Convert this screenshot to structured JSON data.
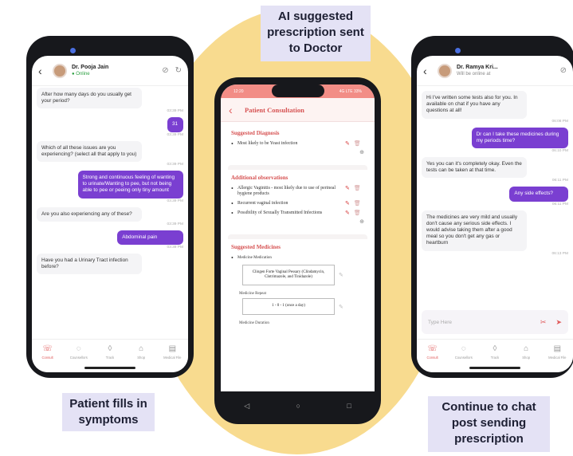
{
  "captions": {
    "top": "AI suggested prescription sent to Doctor",
    "left": "Patient fills in symptoms",
    "right": "Continue to chat post sending prescription"
  },
  "tabs": [
    "Consult",
    "Counsellors",
    "Track",
    "Shop",
    "Medical File"
  ],
  "phone1": {
    "doctor_name": "Dr. Pooja Jain",
    "status": "Online",
    "messages": [
      {
        "dir": "in",
        "text": "After how many days do you usually get your period?",
        "time": "03:39 PM"
      },
      {
        "dir": "out",
        "text": "31",
        "time": "03:39 PM"
      },
      {
        "dir": "in",
        "text": "Which of all these issues are you experiencing? (select all that apply to you)",
        "time": "03:39 PM"
      },
      {
        "dir": "out",
        "text": "Strong and continuous feeling of wanting to urinate/Wanting to pee, but not being able to pee or peeing only tiny amount",
        "time": "03:39 PM"
      },
      {
        "dir": "in",
        "text": "Are you also experiencing any of these?",
        "time": "03:39 PM"
      },
      {
        "dir": "out",
        "text": "Abdominal pain",
        "time": "03:39 PM"
      },
      {
        "dir": "in",
        "text": "Have you had a Urinary Tract infection before?",
        "time": ""
      }
    ]
  },
  "phone2": {
    "status_time": "12:20",
    "status_right": "4G LTE 33%",
    "title": "Patient Consultation",
    "diagnosis_title": "Suggested Diagnosis",
    "diagnosis": [
      "Most likely to be Yeast infection"
    ],
    "obs_title": "Additional observations",
    "observations": [
      "Allergic Vaginitis - most likely due to use of perineal hygiene products",
      "Recurrent vaginal infection",
      "Possibility of Sexually Transmitted Infections"
    ],
    "med_title": "Suggested Medicines",
    "med_item": "Medicine Medication",
    "med_name": "Clingen Forte Vaginal Pessary (Clindamycin, Clotrimazole, and Tinidazole)",
    "repeat_label": "Medicine Repeat",
    "repeat_value": "1 - 0 - 1 (once a day)",
    "duration_label": "Medicine Duration"
  },
  "phone3": {
    "doctor_name": "Dr. Ramya Kri...",
    "status": "Will be online at",
    "messages": [
      {
        "dir": "in",
        "text": "Hi I've written some tests also for you. In available on chat if you have any questions at all!",
        "time": "06:08 PM"
      },
      {
        "dir": "out",
        "text": "Dr can I take these medicines during my periods time?",
        "time": "06:10 PM"
      },
      {
        "dir": "in",
        "text": "Yes you can it's completely okay. Even the tests can be taken at that time.",
        "time": "06:11 PM"
      },
      {
        "dir": "out",
        "text": "Any side effects?",
        "time": "06:11 PM"
      },
      {
        "dir": "in",
        "text": "The medicines are very mild and usually don't cause any serious side effects. I would advise taking them after a good meal so you don't get any gas or heartburn",
        "time": "06:13 PM"
      }
    ],
    "type_placeholder": "Type Here"
  }
}
